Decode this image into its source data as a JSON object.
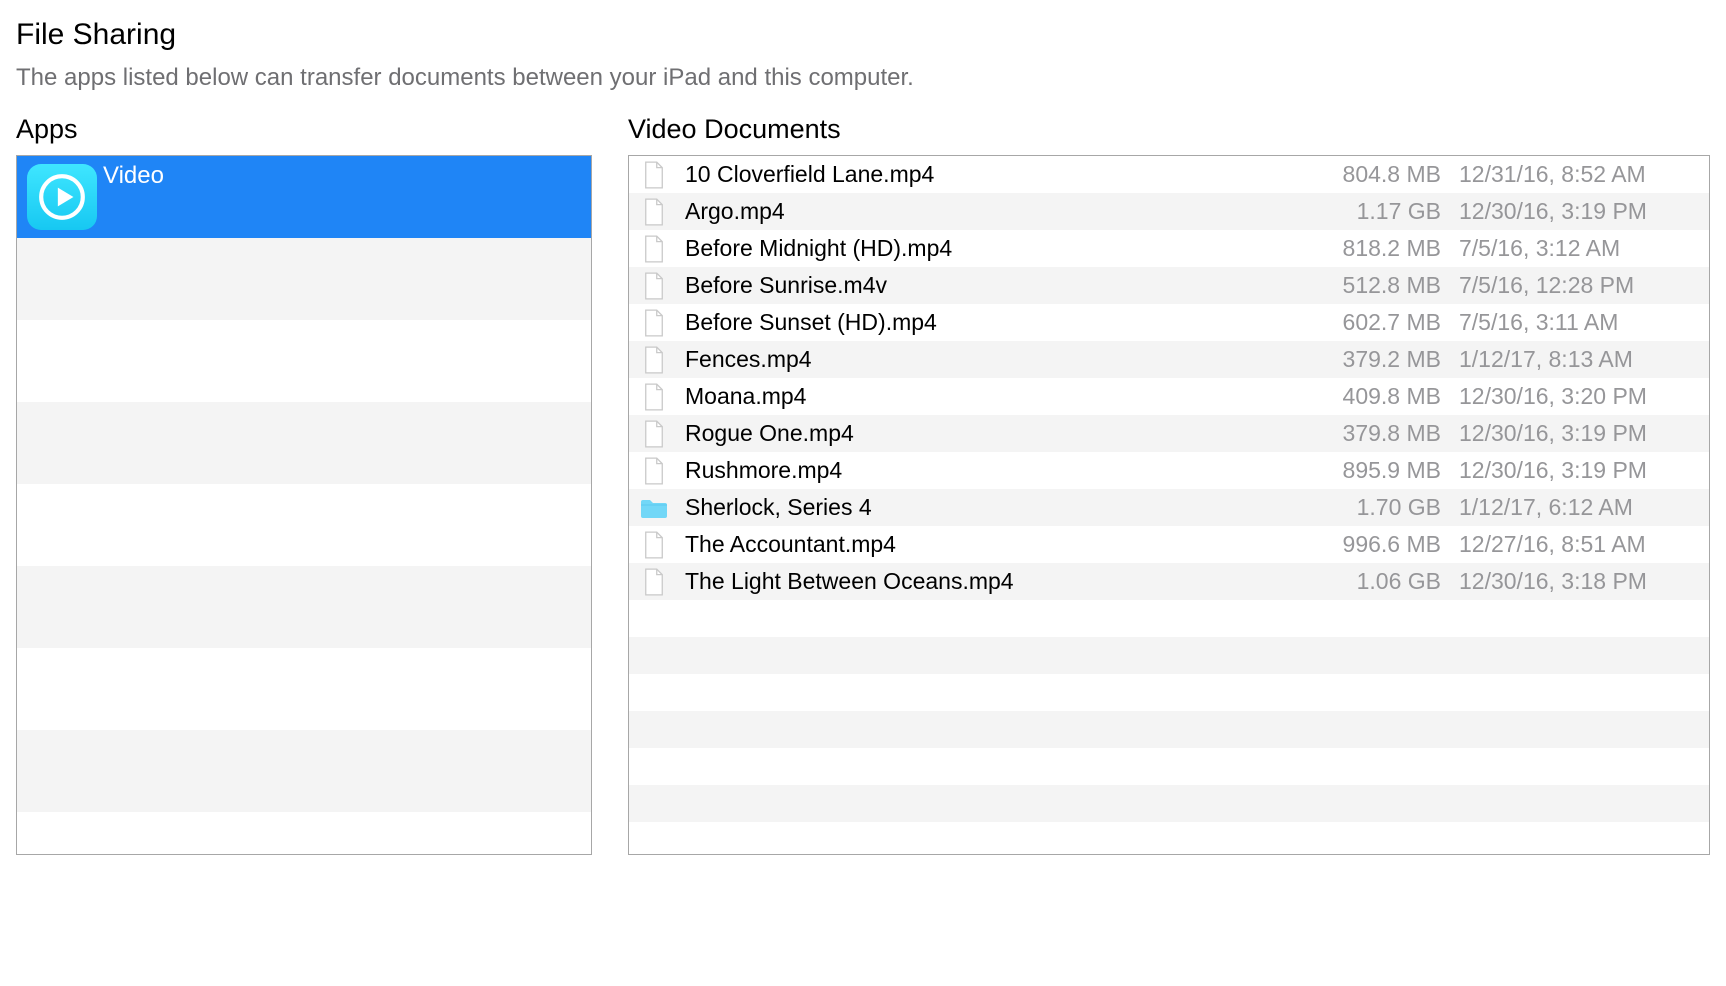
{
  "header": {
    "title": "File Sharing",
    "subtitle": "The apps listed below can transfer documents between your iPad and this computer."
  },
  "apps_section_label": "Apps",
  "docs_section_label": "Video Documents",
  "apps": [
    {
      "name": "Video",
      "selected": true
    }
  ],
  "documents": [
    {
      "icon": "file",
      "name": "10 Cloverfield Lane.mp4",
      "size": "804.8 MB",
      "date": "12/31/16, 8:52 AM"
    },
    {
      "icon": "file",
      "name": "Argo.mp4",
      "size": "1.17 GB",
      "date": "12/30/16, 3:19 PM"
    },
    {
      "icon": "file",
      "name": "Before Midnight (HD).mp4",
      "size": "818.2 MB",
      "date": "7/5/16, 3:12 AM"
    },
    {
      "icon": "file",
      "name": "Before Sunrise.m4v",
      "size": "512.8 MB",
      "date": "7/5/16, 12:28 PM"
    },
    {
      "icon": "file",
      "name": "Before Sunset (HD).mp4",
      "size": "602.7 MB",
      "date": "7/5/16, 3:11 AM"
    },
    {
      "icon": "file",
      "name": "Fences.mp4",
      "size": "379.2 MB",
      "date": "1/12/17, 8:13 AM"
    },
    {
      "icon": "file",
      "name": "Moana.mp4",
      "size": "409.8 MB",
      "date": "12/30/16, 3:20 PM"
    },
    {
      "icon": "file",
      "name": "Rogue One.mp4",
      "size": "379.8 MB",
      "date": "12/30/16, 3:19 PM"
    },
    {
      "icon": "file",
      "name": "Rushmore.mp4",
      "size": "895.9 MB",
      "date": "12/30/16, 3:19 PM"
    },
    {
      "icon": "folder",
      "name": "Sherlock, Series 4",
      "size": "1.70 GB",
      "date": "1/12/17, 6:12 AM"
    },
    {
      "icon": "file",
      "name": "The Accountant.mp4",
      "size": "996.6 MB",
      "date": "12/27/16, 8:51 AM"
    },
    {
      "icon": "file",
      "name": "The Light Between Oceans.mp4",
      "size": "1.06 GB",
      "date": "12/30/16, 3:18 PM"
    }
  ]
}
